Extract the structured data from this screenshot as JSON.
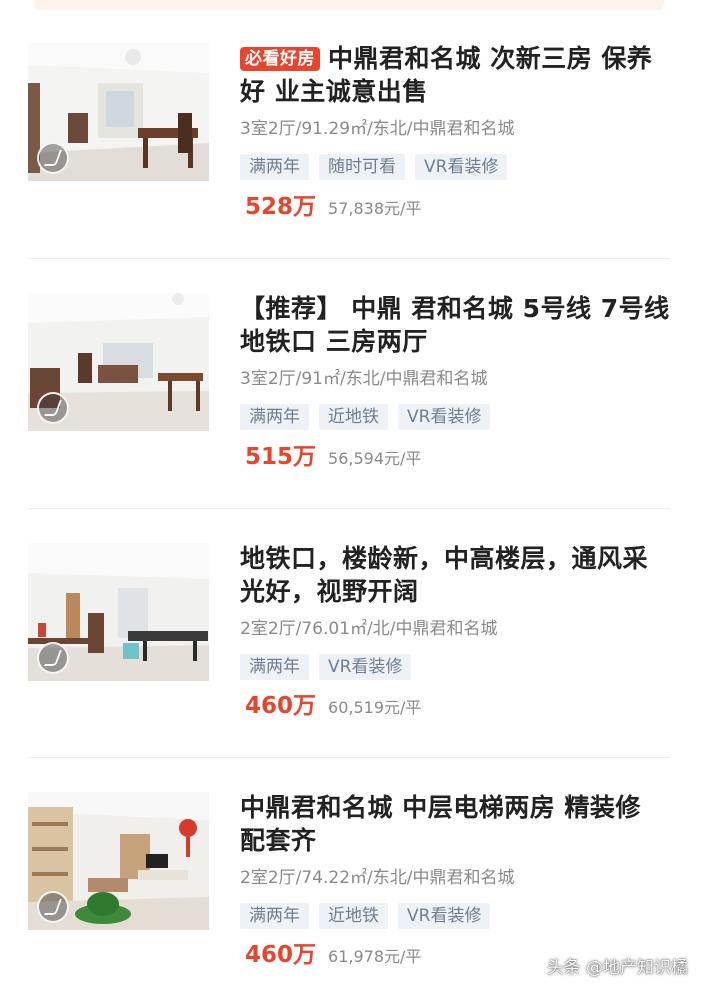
{
  "listings": [
    {
      "hot_badge": "必看好房",
      "title": "中鼎君和名城 次新三房 保养好 业主诚意出售",
      "info": "3室2厅/91.29㎡/东北/中鼎君和名城",
      "tags": [
        "满两年",
        "随时可看",
        "VR看装修"
      ],
      "price": "528万",
      "unit_price": "57,838元/平"
    },
    {
      "hot_badge": "",
      "title": "【推荐】 中鼎 君和名城 5号线 7号线地铁口 三房两厅",
      "info": "3室2厅/91㎡/东北/中鼎君和名城",
      "tags": [
        "满两年",
        "近地铁",
        "VR看装修"
      ],
      "price": "515万",
      "unit_price": "56,594元/平"
    },
    {
      "hot_badge": "",
      "title": "地铁口，楼龄新，中高楼层，通风采光好，视野开阔",
      "info": "2室2厅/76.01㎡/北/中鼎君和名城",
      "tags": [
        "满两年",
        "VR看装修"
      ],
      "price": "460万",
      "unit_price": "60,519元/平"
    },
    {
      "hot_badge": "",
      "title": "中鼎君和名城 中层电梯两房 精装修 配套齐",
      "info": "2室2厅/74.22㎡/东北/中鼎君和名城",
      "tags": [
        "满两年",
        "近地铁",
        "VR看装修"
      ],
      "price": "460万",
      "unit_price": "61,978元/平"
    }
  ],
  "watermark": "头条 @地产知识橘",
  "colors": {
    "accent_red": "#e8452c",
    "tag_bg": "#eef1f6",
    "tag_text": "#6d7f94",
    "meta_text": "#8a8a8a",
    "title_text": "#222222"
  }
}
